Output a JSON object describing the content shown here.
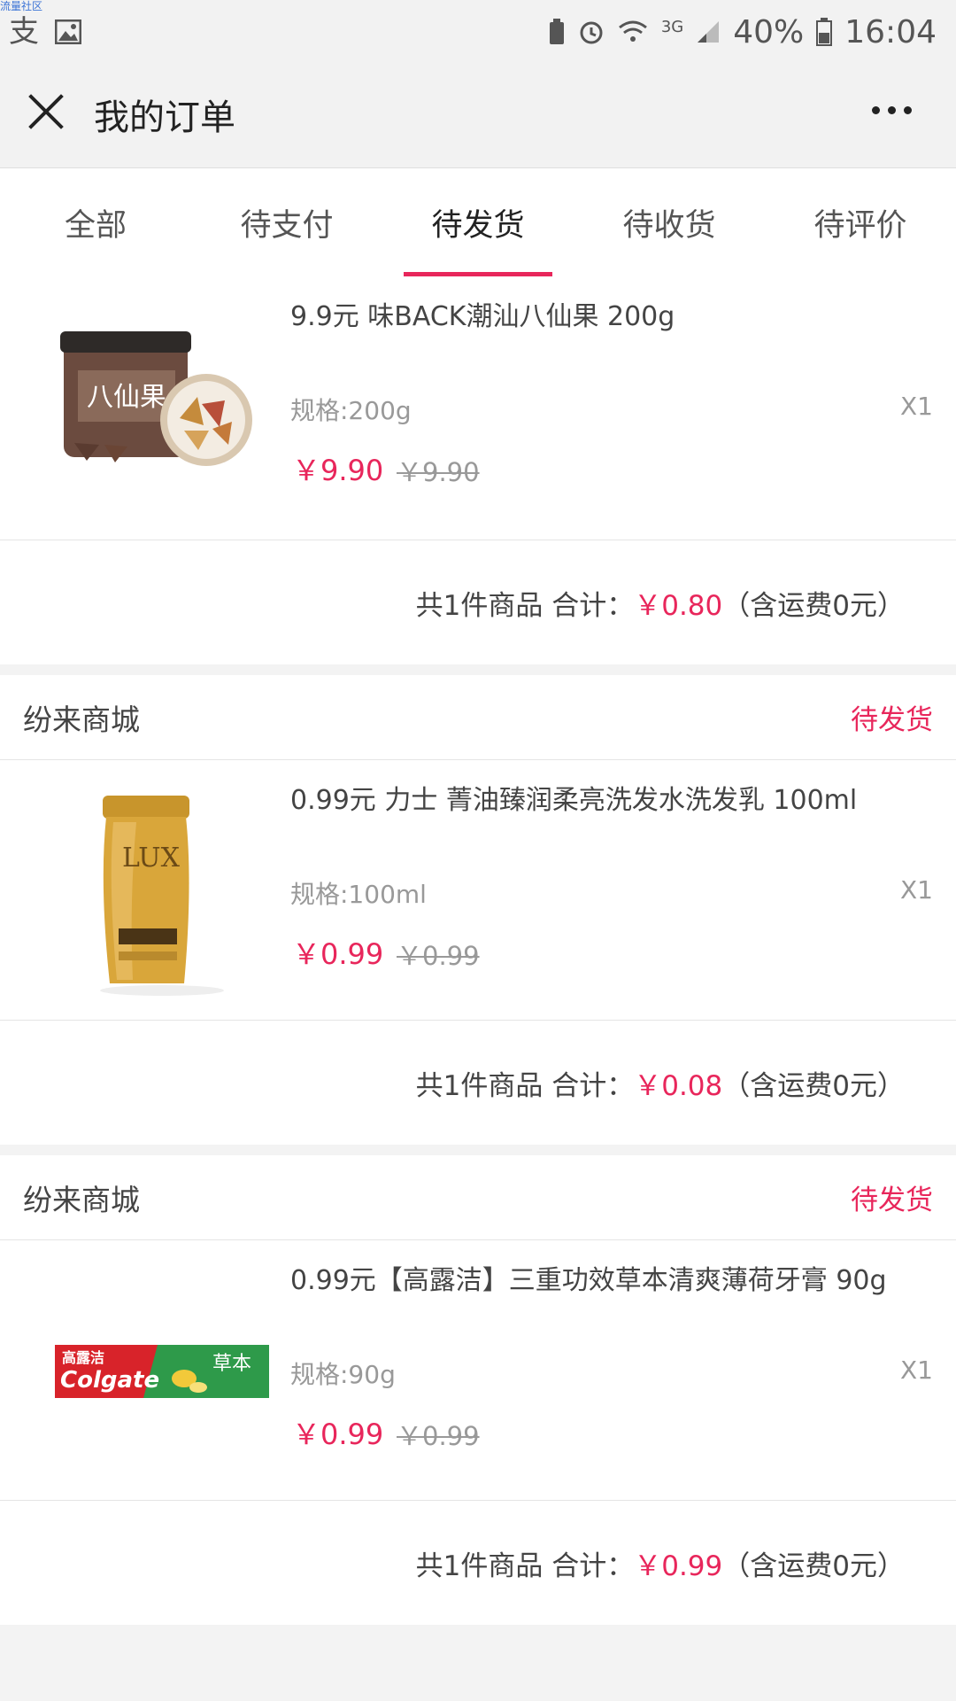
{
  "status_bar": {
    "watermark": "流量社区",
    "left_icons": [
      "alipay-icon",
      "image-icon"
    ],
    "network": "3G",
    "battery": "40%",
    "time": "16:04"
  },
  "nav": {
    "title": "我的订单"
  },
  "tabs": [
    {
      "label": "全部",
      "active": false
    },
    {
      "label": "待支付",
      "active": false
    },
    {
      "label": "待发货",
      "active": true
    },
    {
      "label": "待收货",
      "active": false
    },
    {
      "label": "待评价",
      "active": false
    }
  ],
  "orders": [
    {
      "shop_name": "",
      "status": "",
      "item": {
        "title": "9.9元 味BACK潮汕八仙果 200g",
        "spec": "规格:200g",
        "qty": "X1",
        "price": "￥9.90",
        "original_price": "￥9.90",
        "image": "preserved-fruit-jar"
      },
      "summary": {
        "prefix": "共1件商品 合计：",
        "amount": "￥0.80",
        "suffix": "（含运费0元）"
      }
    },
    {
      "shop_name": "纷来商城",
      "status": "待发货",
      "item": {
        "title": "0.99元 力士 菁油臻润柔亮洗发水洗发乳 100ml",
        "spec": "规格:100ml",
        "qty": "X1",
        "price": "￥0.99",
        "original_price": "￥0.99",
        "image": "lux-shampoo-bottle",
        "brand": "LUX"
      },
      "summary": {
        "prefix": "共1件商品 合计：",
        "amount": "￥0.08",
        "suffix": "（含运费0元）"
      }
    },
    {
      "shop_name": "纷来商城",
      "status": "待发货",
      "item": {
        "title": "0.99元【高露洁】三重功效草本清爽薄荷牙膏 90g",
        "spec": "规格:90g",
        "qty": "X1",
        "price": "￥0.99",
        "original_price": "￥0.99",
        "image": "colgate-toothpaste-box",
        "brand": "Colgate",
        "box_text": "草本"
      },
      "summary": {
        "prefix": "共1件商品 合计：",
        "amount": "￥0.99",
        "suffix": "（含运费0元）"
      }
    }
  ],
  "colors": {
    "accent": "#e8265b",
    "background": "#f3f3f3"
  }
}
